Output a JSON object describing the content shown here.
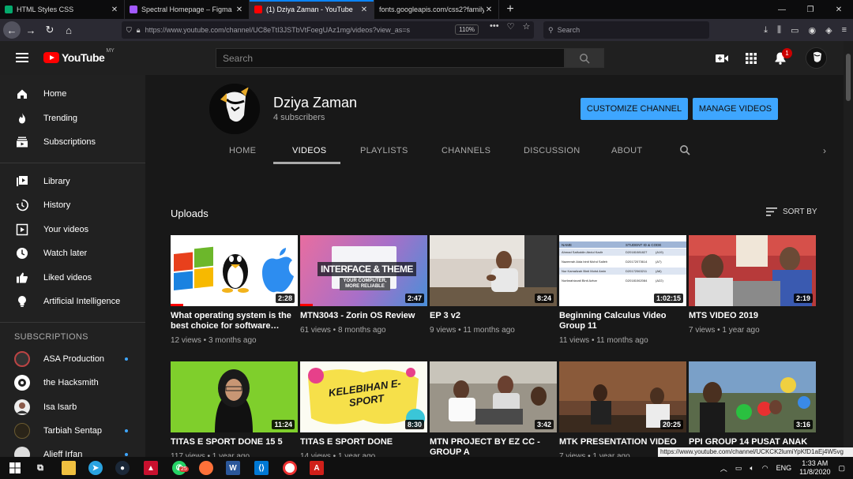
{
  "browser": {
    "tabs": [
      {
        "label": "HTML Styles CSS",
        "color": "#04aa6d"
      },
      {
        "label": "Spectral Homepage – Figma",
        "color": "#a259ff"
      },
      {
        "label": "(1) Dziya Zaman - YouTube",
        "color": "#ff0000"
      },
      {
        "label": "fonts.googleapis.com/css2?family…",
        "color": "#888888"
      }
    ],
    "url": "https://www.youtube.com/channel/UC8eTtI3JSTbVtFoegUAz1mg/videos?view_as=s",
    "zoom": "110%",
    "search_placeholder": "Search"
  },
  "header": {
    "logo": "YouTube",
    "region": "MY",
    "search_placeholder": "Search",
    "notification_count": "1"
  },
  "sidebar": {
    "main": [
      {
        "label": "Home",
        "icon": "home-icon"
      },
      {
        "label": "Trending",
        "icon": "flame-icon"
      },
      {
        "label": "Subscriptions",
        "icon": "subscriptions-icon"
      }
    ],
    "library": [
      {
        "label": "Library",
        "icon": "library-icon"
      },
      {
        "label": "History",
        "icon": "history-icon"
      },
      {
        "label": "Your videos",
        "icon": "your-videos-icon"
      },
      {
        "label": "Watch later",
        "icon": "clock-icon"
      },
      {
        "label": "Liked videos",
        "icon": "thumbs-up-icon"
      },
      {
        "label": "Artificial Intelligence",
        "icon": "lightbulb-icon"
      }
    ],
    "subscriptions_heading": "SUBSCRIPTIONS",
    "subscriptions": [
      {
        "label": "ASA Production",
        "new": true
      },
      {
        "label": "the Hacksmith",
        "new": false
      },
      {
        "label": "Isa Isarb",
        "new": false
      },
      {
        "label": "Tarbiah Sentap",
        "new": true
      },
      {
        "label": "Alieff Irfan",
        "new": true
      }
    ]
  },
  "channel": {
    "name": "Dziya Zaman",
    "subscribers": "4 subscribers",
    "customize_label": "CUSTOMIZE CHANNEL",
    "manage_label": "MANAGE VIDEOS",
    "tabs": [
      "HOME",
      "VIDEOS",
      "PLAYLISTS",
      "CHANNELS",
      "DISCUSSION",
      "ABOUT"
    ],
    "active_tab": "VIDEOS"
  },
  "uploads": {
    "heading": "Uploads",
    "sort_label": "SORT BY",
    "videos": [
      {
        "title": "What operating system is the best choice for software…",
        "views": "12 views",
        "age": "3 months ago",
        "duration": "2:28",
        "progress": 0.1
      },
      {
        "title": "MTN3043 - Zorin OS Review",
        "views": "61 views",
        "age": "8 months ago",
        "duration": "2:47",
        "progress": 0.1
      },
      {
        "title": "EP 3 v2",
        "views": "9 views",
        "age": "11 months ago",
        "duration": "8:24",
        "progress": 0
      },
      {
        "title": "Beginning Calculus Video Group 11",
        "views": "11 views",
        "age": "11 months ago",
        "duration": "1:02:15",
        "progress": 0
      },
      {
        "title": "MTS VIDEO 2019",
        "views": "7 views",
        "age": "1 year ago",
        "duration": "2:19",
        "progress": 0
      },
      {
        "title": "TITAS E SPORT DONE 15 5",
        "views": "117 views",
        "age": "1 year ago",
        "duration": "11:24",
        "progress": 0
      },
      {
        "title": "TITAS E SPORT DONE",
        "views": "14 views",
        "age": "1 year ago",
        "duration": "8:30",
        "progress": 0
      },
      {
        "title": "MTN PROJECT BY EZ CC -GROUP A",
        "views": "",
        "age": "",
        "duration": "3:42",
        "progress": 0
      },
      {
        "title": "MTK PRESENTATION VIDEO",
        "views": "7 views",
        "age": "1 year ago",
        "duration": "20:25",
        "progress": 0
      },
      {
        "title": "PPI GROUP 14 PUSAT ANAK",
        "views": "",
        "age": "",
        "duration": "3:16",
        "progress": 0
      }
    ],
    "thumb2_text1": "INTERFACE & THEME",
    "thumb2_text2": "YOUR COMPUTER, MORE RELIABLE",
    "thumb7_text": "KELEBIHAN E-SPORT",
    "thumb4_header": [
      "NAME",
      "STUDENT ID & CODE"
    ],
    "thumb4_rows": [
      [
        "Ahmad Saifuddin Abdul Kadir",
        "D20181081827",
        "(A19)"
      ],
      [
        "Nazeerah Aida binti Mohd Salleh",
        "D20172073614",
        "(A7)"
      ],
      [
        "Nur Kamalizah Binti Mohd Amin",
        "D20172063211",
        "(A6)"
      ],
      [
        "Nurfarahizzati Binti Azhar",
        "D20181062084",
        "(A22)"
      ]
    ]
  },
  "status_url": "https://www.youtube.com/channel/UCKCK2lumiYpKfD1aEj4W5vg",
  "taskbar": {
    "language": "ENG",
    "time": "1:33 AM",
    "date": "11/8/2020",
    "whatsapp_badge": "25"
  }
}
